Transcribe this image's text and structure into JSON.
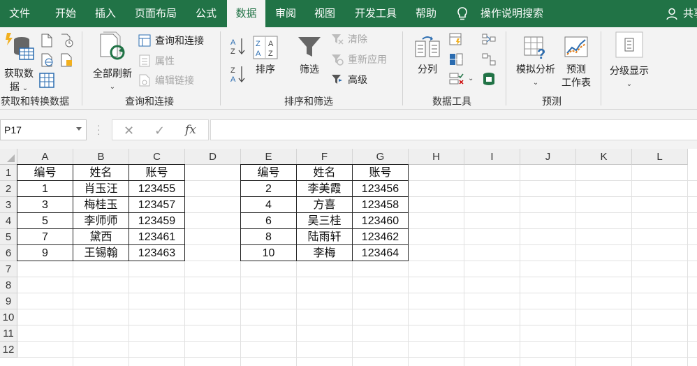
{
  "tabs": [
    "文件",
    "开始",
    "插入",
    "页面布局",
    "公式",
    "数据",
    "审阅",
    "视图",
    "开发工具",
    "帮助"
  ],
  "active_tab": "数据",
  "tell_me": "操作说明搜索",
  "share": "共享",
  "groups": {
    "get": {
      "label": "获取和转换数据",
      "get_data_line1": "获取数",
      "get_data_line2": "据"
    },
    "query": {
      "label": "查询和连接",
      "refresh_all": "全部刷新",
      "queries_connections": "查询和连接",
      "properties": "属性",
      "edit_links": "编辑链接"
    },
    "sort": {
      "label": "排序和筛选",
      "sort": "排序",
      "filter": "筛选",
      "clear": "清除",
      "reapply": "重新应用",
      "advanced": "高级"
    },
    "tools": {
      "label": "数据工具",
      "text_to_columns": "分列"
    },
    "forecast": {
      "label": "预测",
      "what_if": "模拟分析",
      "forecast_sheet_line1": "预测",
      "forecast_sheet_line2": "工作表"
    },
    "outline": {
      "label": "分级显示"
    }
  },
  "icons": {
    "sort_az": "sort-a-to-z-icon",
    "sort_za": "sort-z-to-a-icon",
    "funnel": "filter-funnel-icon"
  },
  "name_box": "P17",
  "formula": "",
  "columns": [
    "A",
    "B",
    "C",
    "D",
    "E",
    "F",
    "G",
    "H",
    "I",
    "J",
    "K",
    "L"
  ],
  "rows": [
    "1",
    "2",
    "3",
    "4",
    "5",
    "6",
    "7",
    "8",
    "9",
    "10",
    "11",
    "12"
  ],
  "table_left": {
    "headers": [
      "编号",
      "姓名",
      "账号"
    ],
    "rows": [
      [
        "1",
        "肖玉汪",
        "123455"
      ],
      [
        "3",
        "梅桂玉",
        "123457"
      ],
      [
        "5",
        "李师师",
        "123459"
      ],
      [
        "7",
        "黛西",
        "123461"
      ],
      [
        "9",
        "王锡翰",
        "123463"
      ]
    ]
  },
  "table_right": {
    "headers": [
      "编号",
      "姓名",
      "账号"
    ],
    "rows": [
      [
        "2",
        "李美霞",
        "123456"
      ],
      [
        "4",
        "方喜",
        "123458"
      ],
      [
        "6",
        "吴三桂",
        "123460"
      ],
      [
        "8",
        "陆雨轩",
        "123462"
      ],
      [
        "10",
        "李梅",
        "123464"
      ]
    ]
  },
  "colors": {
    "accent": "#217346",
    "ribbon_bg": "#f3f3f3"
  }
}
